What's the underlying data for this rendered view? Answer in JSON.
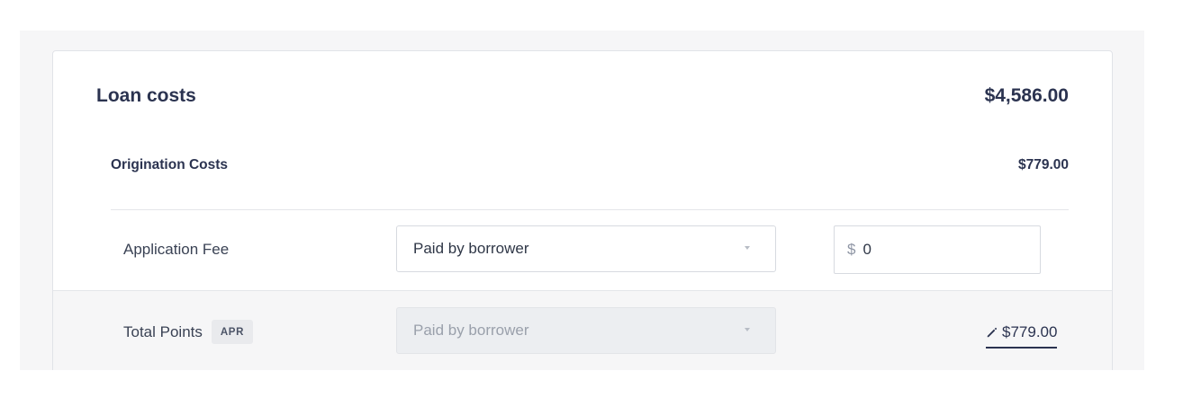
{
  "card": {
    "title": "Loan costs",
    "total": "$4,586.00"
  },
  "section": {
    "title": "Origination Costs",
    "total": "$779.00"
  },
  "rows": [
    {
      "label": "Application Fee",
      "payer": "Paid by borrower",
      "currency_symbol": "$",
      "amount": "0"
    },
    {
      "label": "Total Points",
      "badge": "APR",
      "payer": "Paid by borrower",
      "amount_link": "$779.00",
      "icon": "pencil-icon"
    }
  ],
  "colors": {
    "text": "#2b3350",
    "panel_bg": "#f6f6f7",
    "border": "#d7dae0"
  }
}
